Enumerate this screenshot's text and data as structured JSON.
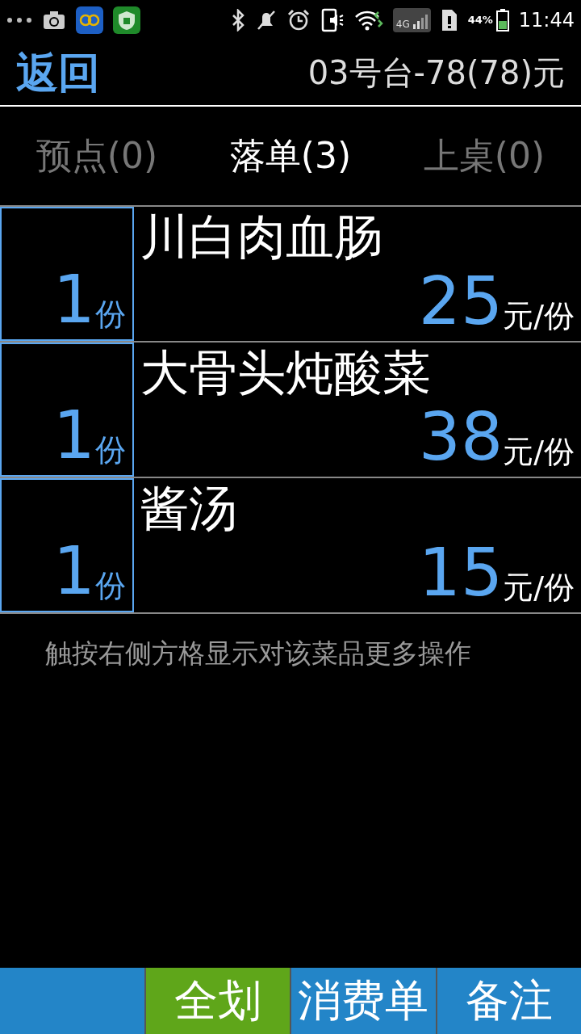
{
  "status_bar": {
    "network": "4G",
    "battery": "44%",
    "time": "11:44"
  },
  "header": {
    "back": "返回",
    "title": "03号台-78(78)元"
  },
  "tabs": [
    {
      "label": "预点(0)",
      "selected": false
    },
    {
      "label": "落单(3)",
      "selected": true
    },
    {
      "label": "上桌(0)",
      "selected": false
    }
  ],
  "items": [
    {
      "quantity": "1",
      "unit": "份",
      "name": "川白肉血肠",
      "price": "25",
      "price_unit": "元/份"
    },
    {
      "quantity": "1",
      "unit": "份",
      "name": "大骨头炖酸菜",
      "price": "38",
      "price_unit": "元/份"
    },
    {
      "quantity": "1",
      "unit": "份",
      "name": "酱汤",
      "price": "15",
      "price_unit": "元/份"
    }
  ],
  "hint": "触按右侧方格显示对该菜品更多操作",
  "bottom_buttons": [
    {
      "kind": "blank"
    },
    {
      "kind": "green",
      "label": "全划"
    },
    {
      "kind": "blue",
      "label": "消费单"
    },
    {
      "kind": "blue",
      "label": "备注"
    }
  ]
}
